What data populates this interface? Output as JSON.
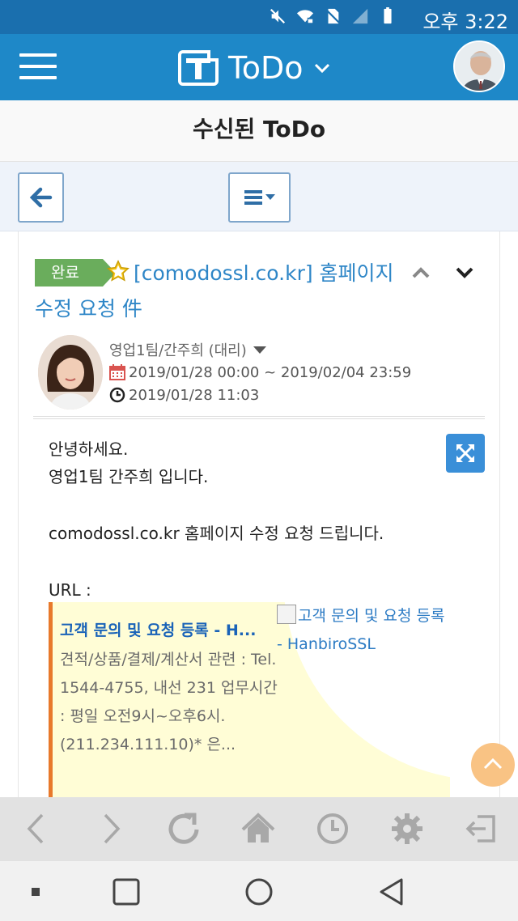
{
  "status_bar": {
    "time": "오후 3:22",
    "icons": [
      "mute-icon",
      "wifi-lock-icon",
      "no-sim-icon",
      "signal-icon",
      "battery-icon"
    ]
  },
  "app_bar": {
    "title": "ToDo",
    "logo_icon": "todo-logo-icon",
    "menu_icon": "hamburger-icon",
    "dropdown_icon": "chevron-down-icon",
    "avatar": "user-avatar"
  },
  "page": {
    "title": "수신된 ToDo"
  },
  "toolbar": {
    "back_icon": "arrow-left-icon",
    "menu_icon": "list-dropdown-icon"
  },
  "todo": {
    "status": "완료",
    "starred": true,
    "subject": "[comodossl.co.kr] 홈페이지 수정 요청 件",
    "author": "영업1팀/간주희 (대리)",
    "period": "2019/01/28 00:00 ~ 2019/02/04 23:59",
    "created": "2019/01/28 11:03",
    "body_lines": [
      "안녕하세요.",
      "영업1팀 간주희 입니다.",
      "",
      "comodossl.co.kr 홈페이지 수정 요청 드립니다.",
      "",
      "URL :"
    ],
    "link_preview": {
      "title": "고객 문의 및 요청 등록 - H...",
      "description": "견적/상품/결제/계산서 관련 : Tel. 1544-4755, 내선 231 업무시간 : 평일 오전9시~오후6시. (211.234.111.10)* 은...",
      "image_alt": "고객 문의 및 요청 등록 - HanbiroSSL"
    }
  },
  "colors": {
    "status_bar": "#1a6fae",
    "app_bar": "#1e88c8",
    "link": "#2e86c7",
    "status_tag": "#6aad5c",
    "preview_border": "#e8792b",
    "preview_bg": "#fffdd6",
    "scroll_top": "#f9c384"
  },
  "browser_nav": [
    "back-icon",
    "forward-icon",
    "reload-icon",
    "home-icon",
    "history-icon",
    "settings-icon",
    "logout-icon"
  ],
  "android_nav": [
    "recent-dot-icon",
    "square-icon",
    "circle-home-icon",
    "triangle-back-icon"
  ]
}
